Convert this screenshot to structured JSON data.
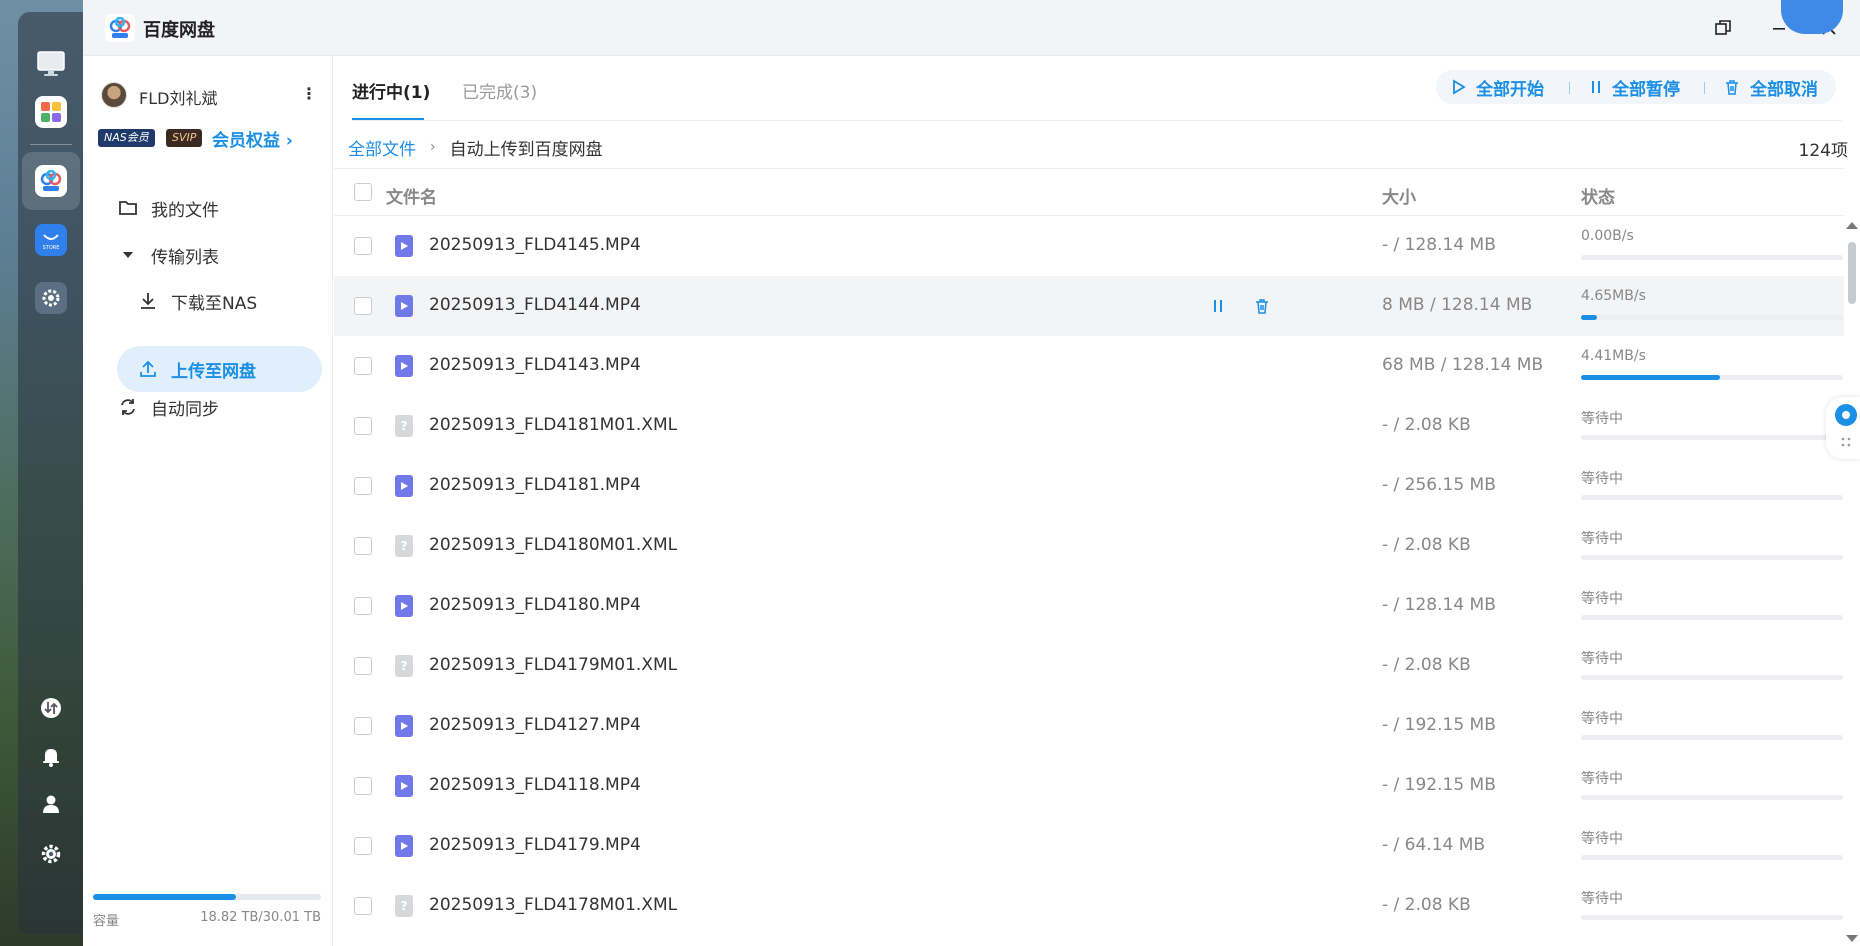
{
  "app": {
    "title": "百度网盘"
  },
  "dock": {
    "icons": [
      "monitor-icon",
      "apps-grid-icon",
      "baidu-netdisk-icon",
      "store-icon",
      "settings-gear-icon",
      "transfer-icon",
      "bell-icon",
      "user-icon",
      "gear-icon"
    ],
    "store_label": "STORE"
  },
  "sidebar": {
    "user_name": "FLD刘礼斌",
    "user_menu": "⋮",
    "badge_nas": "NAS会员",
    "badge_svip": "SVIP",
    "member_link": "会员权益 ›",
    "nav": {
      "my_files": "我的文件",
      "transfer_list": "传输列表",
      "download_nas": "下载至NAS",
      "upload_cloud": "上传至网盘",
      "auto_sync": "自动同步"
    },
    "capacity": {
      "label": "容量",
      "value": "18.82 TB/30.01 TB",
      "used_fraction": 0.627
    }
  },
  "main": {
    "tabs": {
      "active": "进行中(1)",
      "done": "已完成(3)"
    },
    "toolbar": {
      "start_all": "全部开始",
      "pause_all": "全部暂停",
      "cancel_all": "全部取消"
    },
    "breadcrumb": {
      "root": "全部文件",
      "sep": "›",
      "current": "自动上传到百度网盘"
    },
    "item_count": "124项",
    "columns": {
      "name": "文件名",
      "size": "大小",
      "status": "状态"
    },
    "rows": [
      {
        "name": "20250913_FLD4145.MP4",
        "type": "video",
        "size": "- / 128.14 MB",
        "status": "0.00B/s",
        "progress": 0.0
      },
      {
        "name": "20250913_FLD4144.MP4",
        "type": "video",
        "size": "8 MB / 128.14 MB",
        "status": "4.65MB/s",
        "progress": 0.06
      },
      {
        "name": "20250913_FLD4143.MP4",
        "type": "video",
        "size": "68 MB / 128.14 MB",
        "status": "4.41MB/s",
        "progress": 0.53
      },
      {
        "name": "20250913_FLD4181M01.XML",
        "type": "unknown",
        "size": "- / 2.08 KB",
        "status": "等待中",
        "progress": 0.0
      },
      {
        "name": "20250913_FLD4181.MP4",
        "type": "video",
        "size": "- / 256.15 MB",
        "status": "等待中",
        "progress": 0.0
      },
      {
        "name": "20250913_FLD4180M01.XML",
        "type": "unknown",
        "size": "- / 2.08 KB",
        "status": "等待中",
        "progress": 0.0
      },
      {
        "name": "20250913_FLD4180.MP4",
        "type": "video",
        "size": "- / 128.14 MB",
        "status": "等待中",
        "progress": 0.0
      },
      {
        "name": "20250913_FLD4179M01.XML",
        "type": "unknown",
        "size": "- / 2.08 KB",
        "status": "等待中",
        "progress": 0.0
      },
      {
        "name": "20250913_FLD4127.MP4",
        "type": "video",
        "size": "- / 192.15 MB",
        "status": "等待中",
        "progress": 0.0
      },
      {
        "name": "20250913_FLD4118.MP4",
        "type": "video",
        "size": "- / 192.15 MB",
        "status": "等待中",
        "progress": 0.0
      },
      {
        "name": "20250913_FLD4179.MP4",
        "type": "video",
        "size": "- / 64.14 MB",
        "status": "等待中",
        "progress": 0.0
      },
      {
        "name": "20250913_FLD4178M01.XML",
        "type": "unknown",
        "size": "- / 2.08 KB",
        "status": "等待中",
        "progress": 0.0
      }
    ]
  },
  "colors": {
    "accent": "#1b8fe5",
    "video_icon": "#6f79e8"
  }
}
